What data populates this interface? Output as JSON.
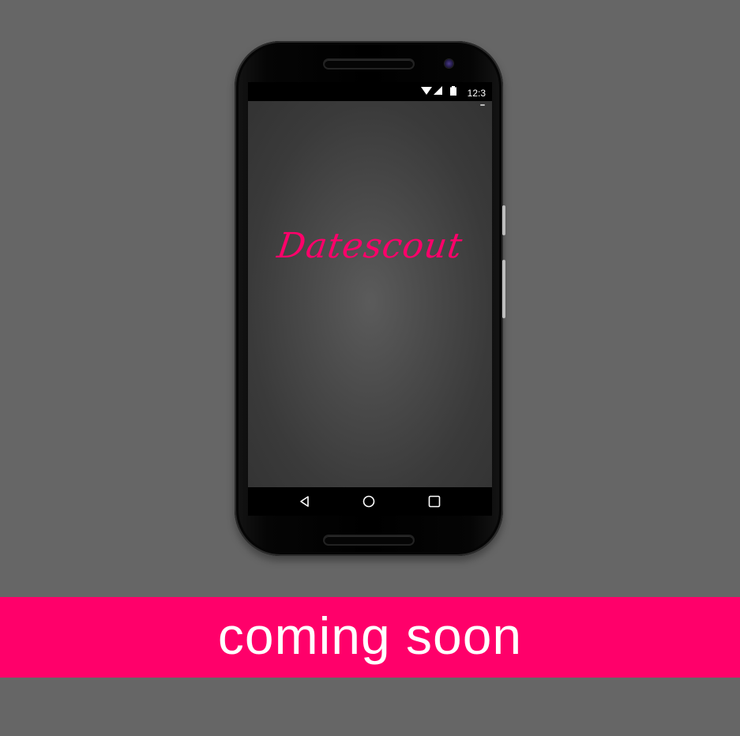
{
  "status_bar": {
    "time": "12:3",
    "icons": [
      "wifi-icon",
      "cellular-signal-icon",
      "battery-icon"
    ]
  },
  "app": {
    "logo_text": "Datescout"
  },
  "nav_bar": {
    "buttons": [
      "back-icon",
      "home-icon",
      "recent-apps-icon"
    ]
  },
  "banner": {
    "text": "coming soon"
  },
  "colors": {
    "background": "#666666",
    "accent": "#ff006a",
    "phone_body": "#000000"
  }
}
